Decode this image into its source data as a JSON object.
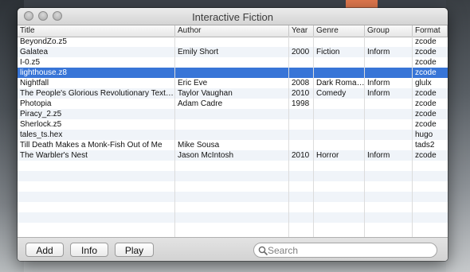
{
  "window": {
    "title": "Interactive Fiction"
  },
  "columns": [
    "Title",
    "Author",
    "Year",
    "Genre",
    "Group",
    "Format"
  ],
  "rows": [
    {
      "title": "BeyondZo.z5",
      "author": "",
      "year": "",
      "genre": "",
      "group": "",
      "format": "zcode"
    },
    {
      "title": "Galatea",
      "author": "Emily Short",
      "year": "2000",
      "genre": "Fiction",
      "group": "Inform",
      "format": "zcode"
    },
    {
      "title": "I-0.z5",
      "author": "",
      "year": "",
      "genre": "",
      "group": "",
      "format": "zcode"
    },
    {
      "title": "lighthouse.z8",
      "author": "",
      "year": "",
      "genre": "",
      "group": "",
      "format": "zcode",
      "selected": true
    },
    {
      "title": "Nightfall",
      "author": "Eric Eve",
      "year": "2008",
      "genre": "Dark Roma…",
      "group": "Inform",
      "format": "glulx"
    },
    {
      "title": "The People's Glorious Revolutionary Text…",
      "author": "Taylor Vaughan",
      "year": "2010",
      "genre": "Comedy",
      "group": "Inform",
      "format": "zcode"
    },
    {
      "title": "Photopia",
      "author": "Adam Cadre",
      "year": "1998",
      "genre": "",
      "group": "",
      "format": "zcode"
    },
    {
      "title": "Piracy_2.z5",
      "author": "",
      "year": "",
      "genre": "",
      "group": "",
      "format": "zcode"
    },
    {
      "title": "Sherlock.z5",
      "author": "",
      "year": "",
      "genre": "",
      "group": "",
      "format": "zcode"
    },
    {
      "title": "tales_ts.hex",
      "author": "",
      "year": "",
      "genre": "",
      "group": "",
      "format": "hugo"
    },
    {
      "title": "Till Death Makes a Monk-Fish Out of Me",
      "author": "Mike Sousa",
      "year": "",
      "genre": "",
      "group": "",
      "format": "tads2"
    },
    {
      "title": "The Warbler's Nest",
      "author": "Jason McIntosh",
      "year": "2010",
      "genre": "Horror",
      "group": "Inform",
      "format": "zcode"
    }
  ],
  "buttons": {
    "add": "Add",
    "info": "Info",
    "play": "Play"
  },
  "search": {
    "placeholder": "Search",
    "value": ""
  },
  "colors": {
    "selection": "#3875d7",
    "alt_row": "#f0f4f9",
    "accent_tab": "#e0784e"
  },
  "icons": {
    "search": "magnifier-icon"
  }
}
